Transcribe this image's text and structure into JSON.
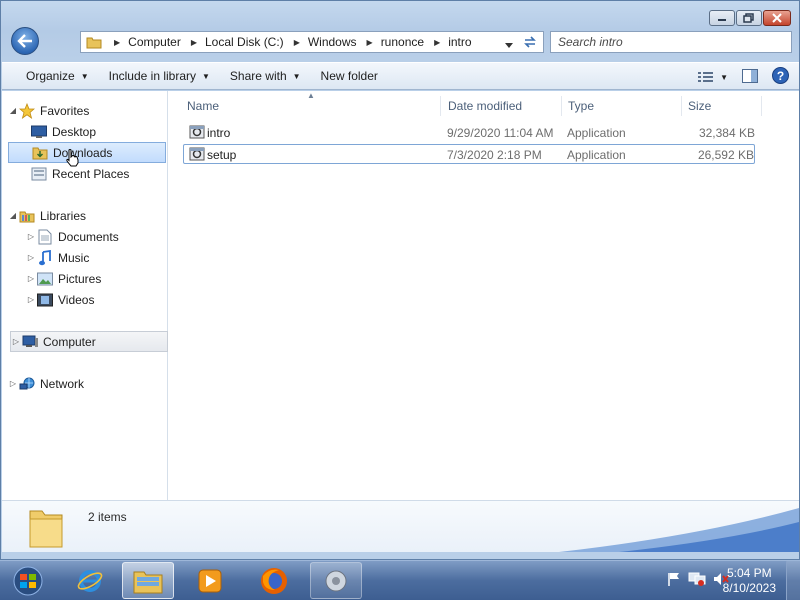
{
  "window": {
    "caption_buttons": {
      "minimize": "minimize",
      "maximize": "maximize",
      "close": "close"
    }
  },
  "address": {
    "breadcrumbs": [
      "Computer",
      "Local Disk (C:)",
      "Windows",
      "runonce",
      "intro"
    ]
  },
  "search": {
    "placeholder": "Search intro"
  },
  "toolbar": {
    "organize": "Organize",
    "include_in_library": "Include in library",
    "share_with": "Share with",
    "new_folder": "New folder"
  },
  "nav": {
    "favorites": "Favorites",
    "desktop": "Desktop",
    "downloads": "Downloads",
    "recent_places": "Recent Places",
    "libraries": "Libraries",
    "documents": "Documents",
    "music": "Music",
    "pictures": "Pictures",
    "videos": "Videos",
    "computer": "Computer",
    "network": "Network"
  },
  "columns": {
    "name": "Name",
    "date_modified": "Date modified",
    "type": "Type",
    "size": "Size"
  },
  "files": [
    {
      "name": "intro",
      "date": "9/29/2020 11:04 AM",
      "type": "Application",
      "size": "32,384 KB"
    },
    {
      "name": "setup",
      "date": "7/3/2020 2:18 PM",
      "type": "Application",
      "size": "26,592 KB"
    }
  ],
  "details": {
    "count": "2 items"
  },
  "taskbar": {
    "apps": [
      "internet-explorer",
      "windows-explorer",
      "media-player",
      "firefox",
      "setup-app"
    ],
    "clock": {
      "time": "5:04 PM",
      "date": "8/10/2023"
    }
  },
  "colors": {
    "accent": "#3d5e91",
    "selection": "#c2dcfd"
  }
}
